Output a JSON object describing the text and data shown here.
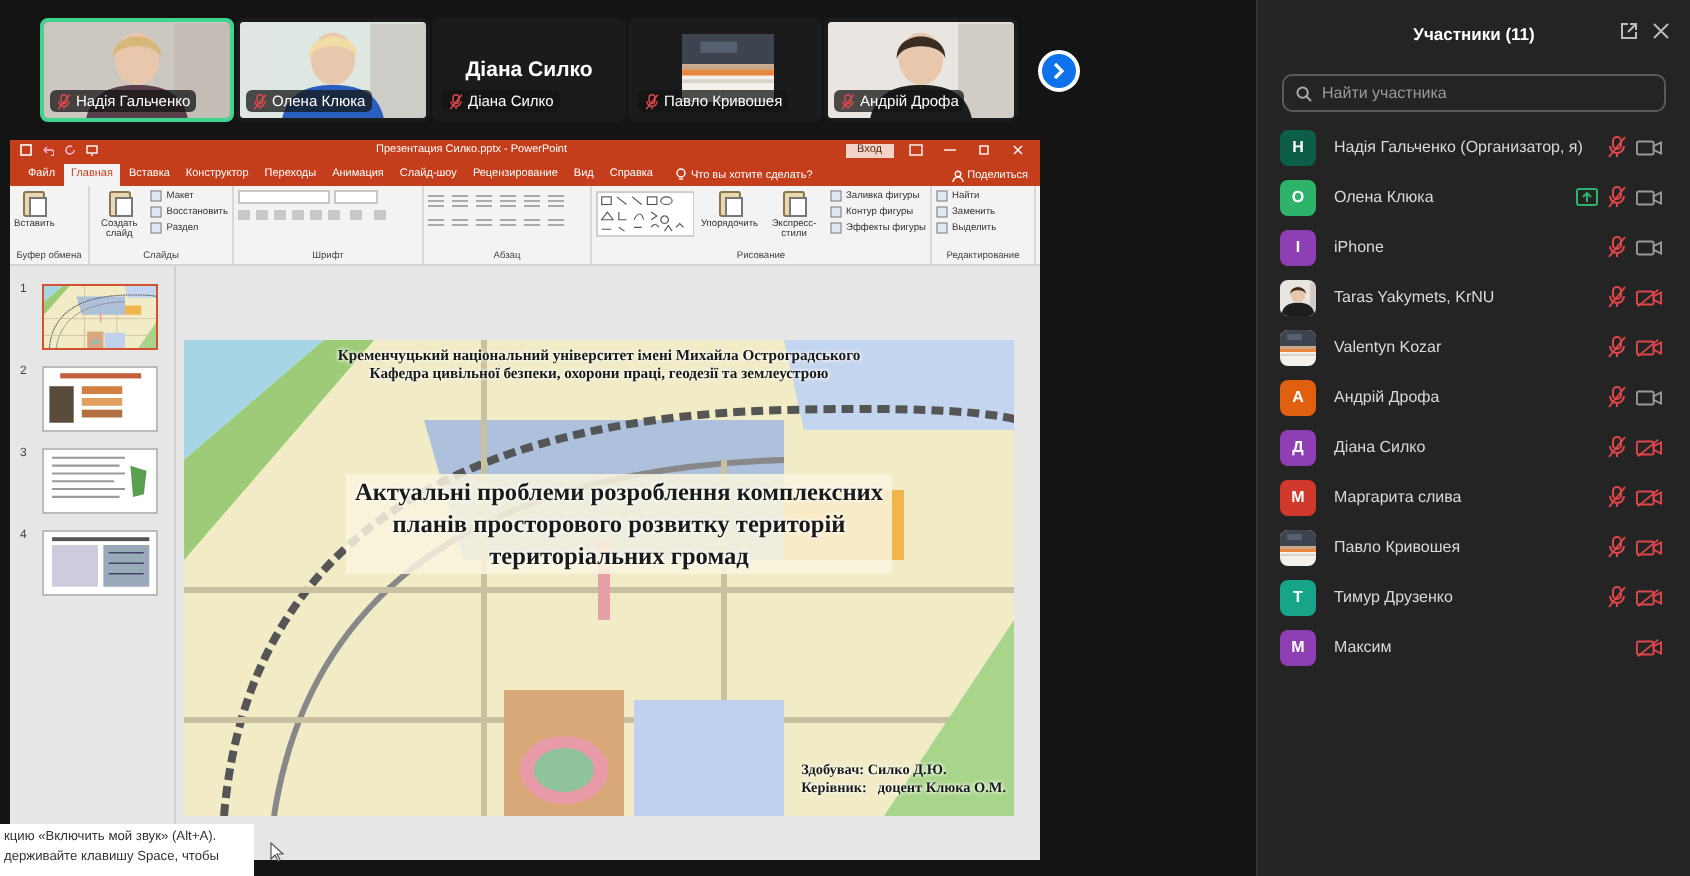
{
  "video_strip": {
    "tiles": [
      {
        "name": "Надія Гальченко",
        "kind": "video",
        "selected": true,
        "mic_muted": true
      },
      {
        "name": "Олена Клюка",
        "kind": "video",
        "selected": false,
        "mic_muted": true
      },
      {
        "name": "Діана Силко",
        "kind": "name_only",
        "display_name": "Діана Силко",
        "selected": false,
        "mic_muted": true
      },
      {
        "name": "Павло Кривошея",
        "kind": "avatar",
        "selected": false,
        "mic_muted": true
      },
      {
        "name": "Андрій Дрофа",
        "kind": "video",
        "selected": false,
        "mic_muted": true
      }
    ]
  },
  "presentation": {
    "window_title": "Презентация Силко.pptx - PowerPoint",
    "sign_in": "Вход",
    "tabs": [
      {
        "label": "Файл",
        "selected": false
      },
      {
        "label": "Главная",
        "selected": true
      },
      {
        "label": "Вставка",
        "selected": false
      },
      {
        "label": "Конструктор",
        "selected": false
      },
      {
        "label": "Переходы",
        "selected": false
      },
      {
        "label": "Анимация",
        "selected": false
      },
      {
        "label": "Слайд-шоу",
        "selected": false
      },
      {
        "label": "Рецензирование",
        "selected": false
      },
      {
        "label": "Вид",
        "selected": false
      },
      {
        "label": "Справка",
        "selected": false
      }
    ],
    "tell_me": "Что вы хотите сделать?",
    "share": "Поделиться",
    "ribbon_groups": [
      {
        "label": "Буфер обмена",
        "kind": "commands",
        "items": [
          {
            "label": "Вставить",
            "kind": "large"
          }
        ]
      },
      {
        "label": "Слайды",
        "kind": "commands",
        "items": [
          {
            "label": "Создать слайд",
            "kind": "large"
          },
          {
            "label": "Макет",
            "kind": "small"
          },
          {
            "label": "Восстановить",
            "kind": "small"
          },
          {
            "label": "Раздел",
            "kind": "small"
          }
        ]
      },
      {
        "label": "Шрифт",
        "kind": "font"
      },
      {
        "label": "Абзац",
        "kind": "paragraph"
      },
      {
        "label": "Рисование",
        "kind": "drawing",
        "items": [
          {
            "label": "Упорядочить",
            "kind": "large"
          },
          {
            "label": "Экспресс-стили",
            "kind": "large"
          },
          {
            "label": "Заливка фигуры",
            "kind": "small"
          },
          {
            "label": "Контур фигуры",
            "kind": "small"
          },
          {
            "label": "Эффекты фигуры",
            "kind": "small"
          }
        ]
      },
      {
        "label": "Редактирование",
        "kind": "commands",
        "items": [
          {
            "label": "Найти",
            "kind": "small"
          },
          {
            "label": "Заменить",
            "kind": "small"
          },
          {
            "label": "Выделить",
            "kind": "small"
          }
        ]
      }
    ],
    "slides": [
      {
        "number": "1",
        "selected": true
      },
      {
        "number": "2",
        "selected": false
      },
      {
        "number": "3",
        "selected": false
      },
      {
        "number": "4",
        "selected": false
      }
    ],
    "slide": {
      "header_lines": [
        "Кременчуцький національний університет імені Михайла Остроградського",
        "Кафедра цивільної безпеки, охорони праці, геодезії та землеустрою"
      ],
      "title_lines": [
        "Актуальні проблеми розроблення комплексних",
        "планів просторового розвитку територій",
        "територіальних громад"
      ],
      "author_lines": [
        "Здобувач: Силко Д.Ю.",
        "Керівник:   доцент Клюка О.М."
      ]
    }
  },
  "tooltip": {
    "lines": [
      "кцию «Включить мой звук» (Alt+A).",
      "держивайте клавишу Space, чтобы"
    ]
  },
  "participants": {
    "title": "Участники (11)",
    "search": {
      "placeholder": "Найти участника"
    },
    "people": [
      {
        "name": "Надія Гальченко (Организатор, я)",
        "kind": "letter",
        "initial": "Н",
        "color": "#0d5e48",
        "sharing": false,
        "mic_muted": true,
        "video_on": true
      },
      {
        "name": "Олена Клюка",
        "kind": "letter",
        "initial": "О",
        "color": "#2db46a",
        "sharing": true,
        "mic_muted": true,
        "video_on": true
      },
      {
        "name": "iPhone",
        "kind": "letter",
        "initial": "I",
        "color": "#8d3fb3",
        "sharing": false,
        "mic_muted": true,
        "video_on": true
      },
      {
        "name": "Taras Yakymets, KrNU",
        "kind": "picture",
        "sharing": false,
        "mic_muted": true,
        "video_on": false
      },
      {
        "name": "Valentyn Kozar",
        "kind": "picture",
        "sharing": false,
        "mic_muted": true,
        "video_on": false
      },
      {
        "name": "Андрій Дрофа",
        "kind": "letter",
        "initial": "А",
        "color": "#e0600f",
        "sharing": false,
        "mic_muted": true,
        "video_on": true
      },
      {
        "name": "Діана Силко",
        "kind": "letter",
        "initial": "Д",
        "color": "#8d3fb3",
        "sharing": false,
        "mic_muted": true,
        "video_on": false
      },
      {
        "name": "Маргарита слива",
        "kind": "letter",
        "initial": "М",
        "color": "#d0392b",
        "sharing": false,
        "mic_muted": true,
        "video_on": false
      },
      {
        "name": "Павло Кривошея",
        "kind": "picture",
        "sharing": false,
        "mic_muted": true,
        "video_on": false
      },
      {
        "name": "Тимур Друзенко",
        "kind": "letter",
        "initial": "Т",
        "color": "#17a589",
        "sharing": false,
        "mic_muted": true,
        "video_on": false
      },
      {
        "name": "Максим",
        "kind": "letter",
        "initial": "М",
        "color": "#8d3fb3",
        "sharing": false,
        "video_on": false
      }
    ]
  }
}
